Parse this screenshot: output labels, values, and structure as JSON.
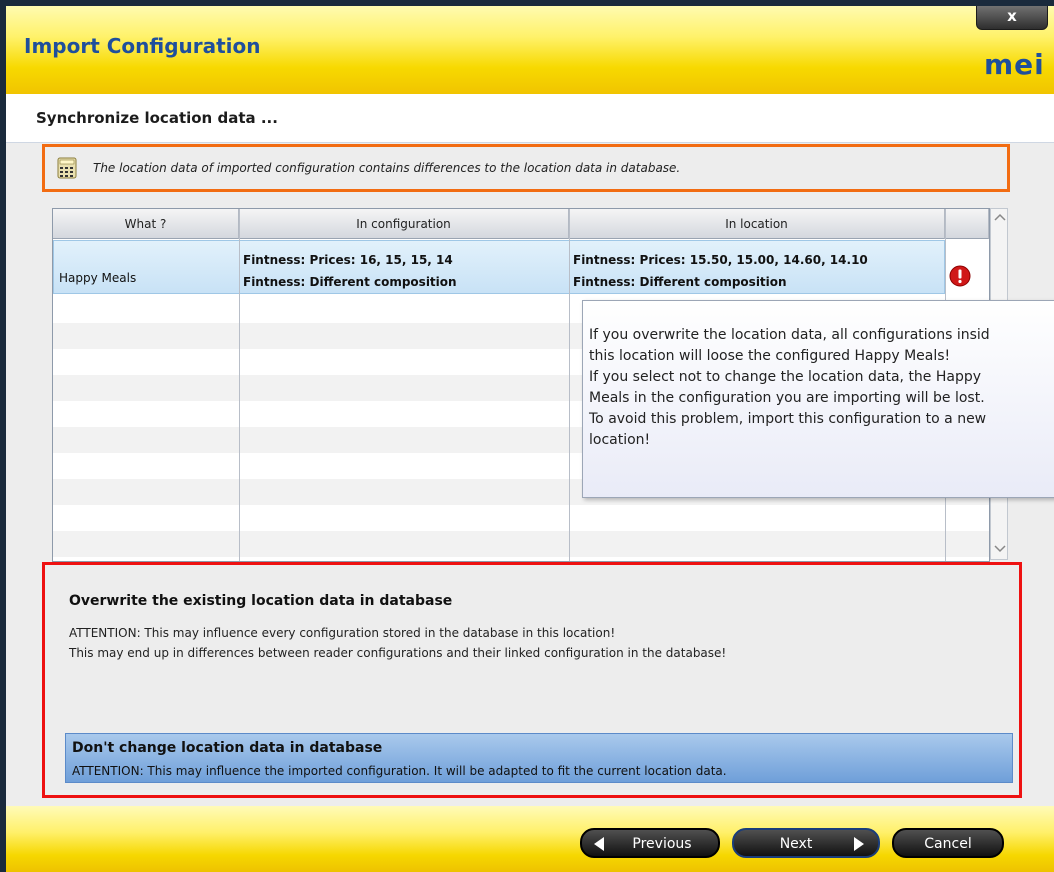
{
  "window": {
    "title": "Import Configuration",
    "close_label": "x",
    "logo_text": "mei"
  },
  "subheader": {
    "title": "Synchronize location data ..."
  },
  "notice": {
    "icon": "calculator-icon",
    "text": "The location data of imported configuration contains differences to the location data in database."
  },
  "table": {
    "columns": [
      "What ?",
      "In configuration",
      "In location"
    ],
    "rows": [
      {
        "what": "Happy Meals",
        "config_line1": "Fintness: Prices: 16, 15, 15, 14",
        "config_line2": "Fintness: Different composition",
        "location_line1": "Fintness: Prices: 15.50, 15.00, 14.60, 14.10",
        "location_line2": "Fintness: Different composition",
        "status_icon": "error-icon"
      }
    ]
  },
  "tooltip": {
    "text": "If you overwrite the location data, all configurations insid\nthis location will loose the configured Happy Meals!\nIf you select not to change the location data, the Happy\nMeals in the configuration you are importing will be lost.\nTo avoid this problem, import this configuration to a new\nlocation!"
  },
  "options": {
    "overwrite": {
      "title": "Overwrite the existing location data in database",
      "line1": "ATTENTION: This may influence every configuration stored in the database in this location!",
      "line2": "This may end up in differences between reader configurations and their linked configuration in the database!"
    },
    "keep": {
      "title": "Don't change location data in database",
      "text": "ATTENTION: This may influence the imported configuration. It will be adapted to fit the current location data.",
      "selected": true
    }
  },
  "footer": {
    "previous_label": "Previous",
    "next_label": "Next",
    "cancel_label": "Cancel"
  },
  "colors": {
    "title_blue": "#1f4f9c",
    "notice_border": "#f26c12",
    "options_border": "#e11111",
    "selected_option": "#6f9fd9"
  }
}
